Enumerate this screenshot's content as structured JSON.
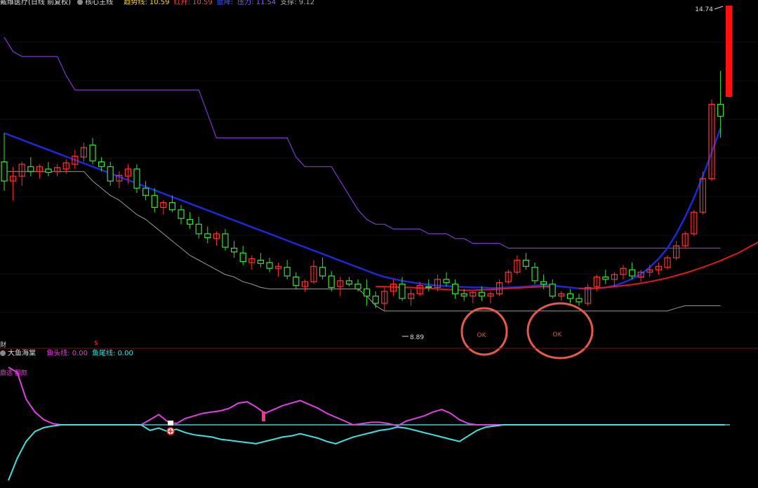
{
  "main_header": {
    "title": "戴维医疗(日线 前复权)",
    "indicator_name": "核心主线",
    "items": [
      {
        "label": "趋势线:",
        "value": "10.59",
        "color": "#ffd23c"
      },
      {
        "label": "红升:",
        "value": "10.59",
        "color": "#ff4040"
      },
      {
        "label": "蓝降:",
        "value": "",
        "color": "#4060ff"
      },
      {
        "label": "压力:",
        "value": "11.54",
        "color": "#8b63ff"
      },
      {
        "label": "支撑:",
        "value": "9.12",
        "color": "#aaaaaa"
      }
    ]
  },
  "sub_header": {
    "indicator_name": "大鱼海棠",
    "items": [
      {
        "label": "鱼头线:",
        "value": "0.00",
        "color": "#e040e0"
      },
      {
        "label": "鱼尾线:",
        "value": "0.00",
        "color": "#40e0e0"
      }
    ]
  },
  "side_labels": {
    "top_left": "财",
    "sub_top_left": "鼎选 翻颜",
    "divider_marker": "$"
  },
  "chart_data": [
    {
      "type": "candlestick",
      "title": "",
      "price_labels": {
        "high": "14.74",
        "low": "8.89"
      },
      "annotations": [
        "OK",
        "OK"
      ],
      "colors": {
        "up": "#ff3232",
        "down": "#3cdc3c",
        "ma_blue": "#1a2ad8",
        "ma_red": "#e01818",
        "resistance": "#7a3ad0",
        "support": "#9a9a9a",
        "circle": "#e55a4a"
      },
      "ylim": [
        8.2,
        15.2
      ],
      "candles": [
        [
          12.0,
          12.6,
          11.4,
          11.6
        ],
        [
          11.6,
          11.9,
          11.2,
          11.7
        ],
        [
          11.7,
          12.0,
          11.5,
          11.95
        ],
        [
          11.9,
          12.1,
          11.7,
          11.8
        ],
        [
          11.8,
          11.95,
          11.65,
          11.9
        ],
        [
          11.85,
          12.0,
          11.7,
          11.78
        ],
        [
          11.8,
          11.95,
          11.7,
          11.88
        ],
        [
          11.85,
          12.05,
          11.75,
          11.98
        ],
        [
          11.95,
          12.25,
          11.85,
          12.12
        ],
        [
          12.1,
          12.4,
          12.0,
          12.3
        ],
        [
          12.35,
          12.5,
          11.95,
          12.02
        ],
        [
          12.0,
          12.1,
          11.8,
          11.9
        ],
        [
          11.9,
          12.0,
          11.5,
          11.6
        ],
        [
          11.6,
          11.8,
          11.45,
          11.72
        ],
        [
          11.7,
          11.95,
          11.55,
          11.85
        ],
        [
          11.85,
          11.95,
          11.35,
          11.45
        ],
        [
          11.45,
          11.6,
          11.2,
          11.3
        ],
        [
          11.3,
          11.45,
          10.95,
          11.05
        ],
        [
          11.05,
          11.2,
          10.9,
          11.15
        ],
        [
          11.15,
          11.3,
          10.95,
          11.0
        ],
        [
          11.0,
          11.1,
          10.7,
          10.82
        ],
        [
          10.8,
          10.95,
          10.6,
          10.7
        ],
        [
          10.7,
          10.85,
          10.4,
          10.5
        ],
        [
          10.5,
          10.65,
          10.3,
          10.42
        ],
        [
          10.4,
          10.55,
          10.25,
          10.5
        ],
        [
          10.5,
          10.6,
          10.15,
          10.22
        ],
        [
          10.2,
          10.35,
          10.0,
          10.12
        ],
        [
          10.1,
          10.25,
          9.85,
          9.92
        ],
        [
          9.9,
          10.05,
          9.75,
          9.98
        ],
        [
          9.95,
          10.1,
          9.8,
          9.88
        ],
        [
          9.9,
          10.0,
          9.7,
          9.78
        ],
        [
          9.78,
          9.9,
          9.6,
          9.82
        ],
        [
          9.8,
          9.95,
          9.55,
          9.62
        ],
        [
          9.6,
          9.7,
          9.35,
          9.42
        ],
        [
          9.4,
          9.55,
          9.3,
          9.5
        ],
        [
          9.5,
          9.95,
          9.45,
          9.82
        ],
        [
          9.8,
          10.0,
          9.55,
          9.62
        ],
        [
          9.62,
          9.72,
          9.3,
          9.38
        ],
        [
          9.4,
          9.6,
          9.2,
          9.52
        ],
        [
          9.52,
          9.6,
          9.4,
          9.45
        ],
        [
          9.45,
          9.55,
          9.3,
          9.35
        ],
        [
          9.35,
          9.55,
          9.0,
          9.2
        ],
        [
          9.2,
          9.3,
          8.95,
          9.05
        ],
        [
          9.05,
          9.4,
          8.89,
          9.3
        ],
        [
          9.3,
          9.55,
          9.2,
          9.45
        ],
        [
          9.45,
          9.6,
          9.1,
          9.15
        ],
        [
          9.15,
          9.35,
          9.0,
          9.25
        ],
        [
          9.25,
          9.5,
          9.2,
          9.42
        ],
        [
          9.4,
          9.55,
          9.3,
          9.38
        ],
        [
          9.38,
          9.65,
          9.3,
          9.55
        ],
        [
          9.55,
          9.7,
          9.4,
          9.48
        ],
        [
          9.45,
          9.55,
          9.15,
          9.25
        ],
        [
          9.25,
          9.35,
          9.1,
          9.2
        ],
        [
          9.2,
          9.3,
          9.05,
          9.28
        ],
        [
          9.28,
          9.4,
          9.1,
          9.2
        ],
        [
          9.2,
          9.3,
          9.05,
          9.25
        ],
        [
          9.25,
          9.55,
          9.2,
          9.48
        ],
        [
          9.5,
          9.75,
          9.45,
          9.7
        ],
        [
          9.7,
          10.05,
          9.65,
          9.95
        ],
        [
          9.95,
          10.1,
          9.75,
          9.82
        ],
        [
          9.8,
          9.9,
          9.45,
          9.52
        ],
        [
          9.5,
          9.65,
          9.35,
          9.45
        ],
        [
          9.45,
          9.55,
          9.15,
          9.2
        ],
        [
          9.2,
          9.3,
          9.1,
          9.25
        ],
        [
          9.25,
          9.35,
          9.05,
          9.15
        ],
        [
          9.15,
          9.25,
          9.0,
          9.08
        ],
        [
          9.05,
          9.45,
          9.0,
          9.38
        ],
        [
          9.4,
          9.65,
          9.3,
          9.6
        ],
        [
          9.6,
          9.75,
          9.45,
          9.55
        ],
        [
          9.55,
          9.7,
          9.4,
          9.65
        ],
        [
          9.65,
          9.85,
          9.55,
          9.78
        ],
        [
          9.75,
          9.9,
          9.55,
          9.62
        ],
        [
          9.6,
          9.75,
          9.5,
          9.7
        ],
        [
          9.7,
          9.85,
          9.6,
          9.75
        ],
        [
          9.75,
          9.9,
          9.65,
          9.82
        ],
        [
          9.8,
          10.05,
          9.75,
          10.0
        ],
        [
          10.0,
          10.35,
          9.95,
          10.25
        ],
        [
          10.25,
          10.55,
          10.2,
          10.5
        ],
        [
          10.5,
          11.0,
          10.45,
          10.95
        ],
        [
          10.95,
          11.8,
          10.9,
          11.65
        ],
        [
          11.65,
          13.3,
          11.6,
          13.2
        ],
        [
          13.2,
          13.9,
          12.5,
          12.95
        ]
      ],
      "ma_blue": [
        12.6,
        12.53,
        12.46,
        12.39,
        12.32,
        12.25,
        12.18,
        12.11,
        12.04,
        11.97,
        11.9,
        11.83,
        11.76,
        11.69,
        11.62,
        11.55,
        11.48,
        11.41,
        11.34,
        11.27,
        11.2,
        11.13,
        11.06,
        10.99,
        10.92,
        10.85,
        10.78,
        10.71,
        10.64,
        10.57,
        10.5,
        10.43,
        10.36,
        10.29,
        10.22,
        10.15,
        10.08,
        10.01,
        9.94,
        9.87,
        9.8,
        9.73,
        9.66,
        9.6,
        9.56,
        9.52,
        9.49,
        9.46,
        9.44,
        9.42,
        9.41,
        9.4,
        9.39,
        9.38,
        9.38,
        9.37,
        9.37,
        9.38,
        9.39,
        9.4,
        9.42,
        9.43,
        9.42,
        9.4,
        9.38,
        9.36,
        9.35,
        9.36,
        9.38,
        9.42,
        9.48,
        9.56,
        9.66,
        9.8,
        9.98,
        10.2,
        10.5,
        10.85,
        11.25,
        11.7,
        12.2,
        12.7
      ],
      "ma_red_segments": [
        {
          "from": 42,
          "values": [
            9.4,
            9.4,
            9.39,
            9.38,
            9.38,
            9.37,
            9.36,
            9.35,
            9.34,
            9.33,
            9.32,
            9.32,
            9.33,
            9.34,
            9.35,
            9.36,
            9.37,
            9.38,
            9.39,
            9.4,
            9.4
          ]
        },
        {
          "from": 65,
          "values": [
            9.36,
            9.36,
            9.37,
            9.38,
            9.4,
            9.42,
            9.44,
            9.47,
            9.5,
            9.54,
            9.58,
            9.63,
            9.68,
            9.74,
            9.8,
            9.87,
            9.94,
            10.02,
            10.1,
            10.2,
            10.3,
            10.4,
            10.5
          ]
        }
      ],
      "resistance": [
        14.6,
        14.3,
        14.2,
        14.2,
        14.2,
        14.2,
        14.2,
        13.8,
        13.5,
        13.5,
        13.5,
        13.5,
        13.5,
        13.5,
        13.5,
        13.5,
        13.5,
        13.5,
        13.5,
        13.5,
        13.5,
        13.5,
        13.5,
        13.0,
        12.5,
        12.5,
        12.5,
        12.5,
        12.5,
        12.5,
        12.5,
        12.5,
        12.5,
        12.1,
        11.9,
        11.9,
        11.9,
        11.9,
        11.6,
        11.3,
        11.0,
        10.8,
        10.7,
        10.7,
        10.6,
        10.6,
        10.6,
        10.6,
        10.5,
        10.5,
        10.5,
        10.4,
        10.4,
        10.3,
        10.3,
        10.3,
        10.3,
        10.2,
        10.2,
        10.2,
        10.2,
        10.2,
        10.2,
        10.2,
        10.2,
        10.2,
        10.2,
        10.2,
        10.2,
        10.2,
        10.2,
        10.2,
        10.2,
        10.2,
        10.2,
        10.2,
        10.2,
        10.2,
        10.2,
        10.2,
        10.2,
        10.2
      ],
      "support": [
        11.8,
        11.8,
        11.8,
        11.8,
        11.8,
        11.8,
        11.8,
        11.8,
        11.8,
        11.8,
        11.6,
        11.45,
        11.3,
        11.2,
        11.05,
        10.9,
        10.8,
        10.65,
        10.5,
        10.35,
        10.2,
        10.05,
        9.95,
        9.85,
        9.75,
        9.65,
        9.6,
        9.5,
        9.45,
        9.38,
        9.35,
        9.35,
        9.35,
        9.35,
        9.35,
        9.35,
        9.35,
        9.35,
        9.35,
        9.35,
        9.35,
        9.2,
        9.0,
        8.89,
        8.89,
        8.89,
        8.89,
        8.89,
        8.89,
        8.89,
        8.89,
        8.89,
        8.89,
        8.89,
        8.89,
        8.89,
        8.89,
        8.89,
        8.89,
        8.89,
        8.89,
        8.89,
        8.89,
        8.89,
        8.89,
        8.89,
        8.89,
        8.89,
        8.89,
        8.89,
        8.89,
        8.89,
        8.89,
        8.89,
        8.89,
        8.89,
        8.95,
        9.0,
        9.0,
        9.0,
        9.0,
        9.0
      ]
    },
    {
      "type": "line",
      "title": "",
      "ylim": [
        -110,
        100
      ],
      "colors": {
        "head": "#e040e0",
        "tail": "#40e0e0"
      },
      "series": [
        {
          "name": "鱼头线",
          "values": [
            90,
            82,
            40,
            20,
            8,
            2,
            0,
            0,
            0,
            0,
            0,
            0,
            0,
            0,
            0,
            0,
            8,
            16,
            5,
            2,
            10,
            14,
            18,
            20,
            22,
            26,
            34,
            36,
            28,
            18,
            24,
            30,
            34,
            38,
            32,
            26,
            18,
            12,
            6,
            0,
            2,
            4,
            4,
            2,
            -2,
            6,
            10,
            14,
            20,
            24,
            18,
            8,
            2,
            0,
            0,
            0,
            0,
            0,
            0,
            0,
            0,
            0,
            0,
            0,
            0,
            0,
            0,
            0,
            0,
            0,
            0,
            0,
            0,
            0,
            0,
            0,
            0,
            0,
            0,
            0,
            0,
            0
          ]
        },
        {
          "name": "鱼尾线",
          "values": [
            -100,
            -60,
            -30,
            -12,
            -5,
            -2,
            0,
            0,
            0,
            0,
            0,
            0,
            0,
            0,
            0,
            0,
            -10,
            -6,
            -12,
            -8,
            -14,
            -18,
            -20,
            -22,
            -26,
            -28,
            -30,
            -32,
            -34,
            -30,
            -26,
            -22,
            -20,
            -16,
            -20,
            -24,
            -30,
            -34,
            -28,
            -22,
            -18,
            -14,
            -10,
            -8,
            -4,
            -6,
            -10,
            -14,
            -18,
            -22,
            -26,
            -30,
            -20,
            -10,
            -4,
            -2,
            0,
            0,
            0,
            0,
            0,
            0,
            0,
            0,
            0,
            0,
            0,
            0,
            0,
            0,
            0,
            0,
            0,
            0,
            0,
            0,
            0,
            0,
            0,
            0,
            0,
            0
          ]
        }
      ]
    }
  ]
}
